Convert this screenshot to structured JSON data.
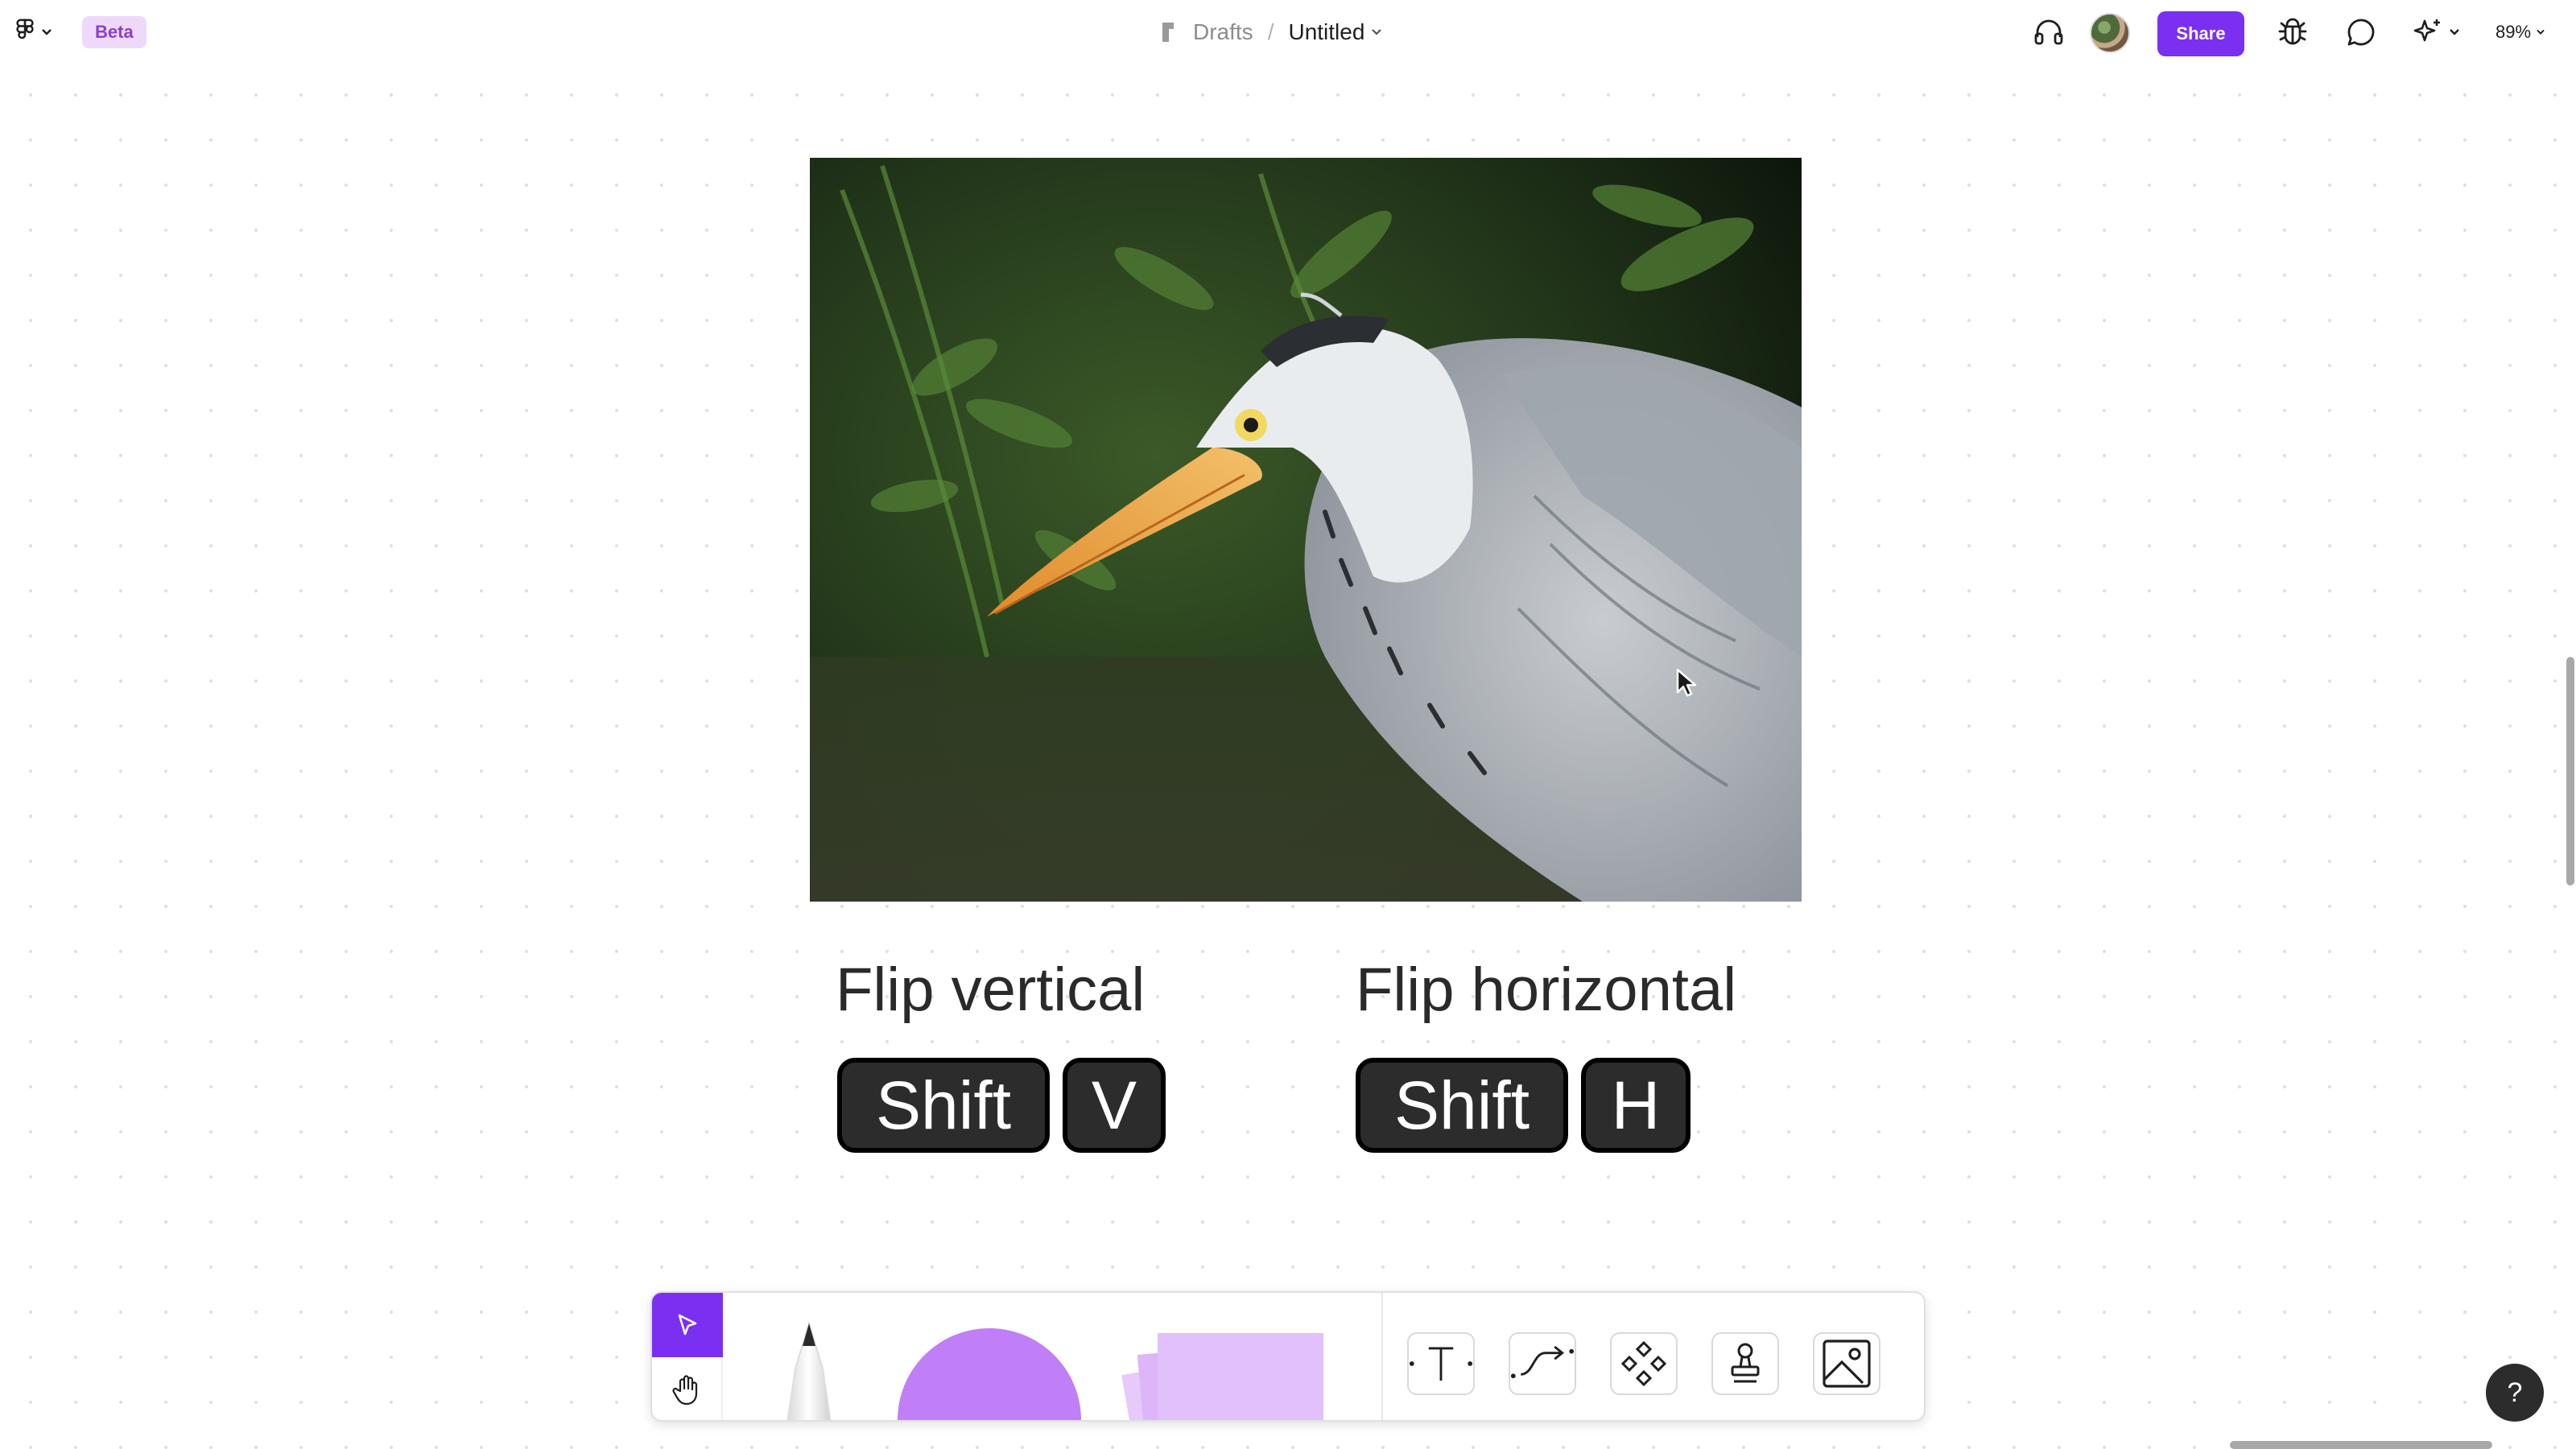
{
  "header": {
    "beta_badge": "Beta",
    "breadcrumb": {
      "drafts": "Drafts",
      "separator": "/",
      "title": "Untitled"
    },
    "share_label": "Share",
    "zoom_level": "89%"
  },
  "canvas": {
    "flip_vertical": {
      "label": "Flip vertical",
      "keys": [
        "Shift",
        "V"
      ]
    },
    "flip_horizontal": {
      "label": "Flip horizontal",
      "keys": [
        "Shift",
        "H"
      ]
    }
  },
  "toolbar": {
    "tools": [
      "move-tool",
      "hand-tool",
      "pen-tool",
      "shape-tool",
      "sticky-note-tool",
      "text-tool",
      "connector-tool",
      "components-tool",
      "stamp-tool",
      "image-tool"
    ],
    "accent_color": "#7b2ff0",
    "shape_color": "#c07ef7",
    "sticky_color": "#e2c0fb"
  },
  "help_label": "?"
}
